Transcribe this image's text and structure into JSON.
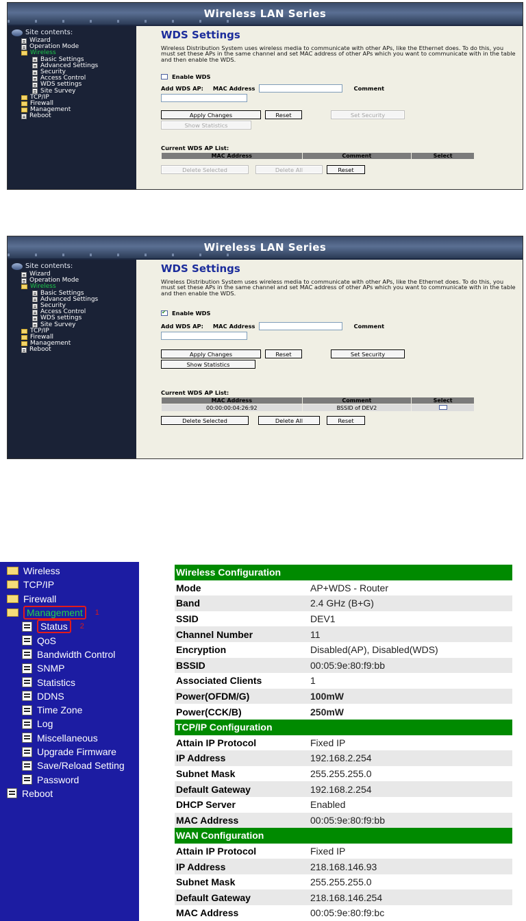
{
  "shot1": {
    "banner": "Wireless LAN Series",
    "site_contents": "Site contents:",
    "nav": [
      {
        "label": "Wizard",
        "icon": "page-icon",
        "level": 1
      },
      {
        "label": "Operation Mode",
        "icon": "page-icon",
        "level": 1
      },
      {
        "label": "Wireless",
        "icon": "folder-open-icon",
        "level": 1,
        "active": true
      },
      {
        "label": "Basic Settings",
        "icon": "page-icon",
        "level": 2
      },
      {
        "label": "Advanced Settings",
        "icon": "page-icon",
        "level": 2
      },
      {
        "label": "Security",
        "icon": "page-icon",
        "level": 2
      },
      {
        "label": "Access Control",
        "icon": "page-icon",
        "level": 2
      },
      {
        "label": "WDS settings",
        "icon": "page-icon",
        "level": 2
      },
      {
        "label": "Site Survey",
        "icon": "page-icon",
        "level": 2
      },
      {
        "label": "TCP/IP",
        "icon": "folder-icon",
        "level": 1
      },
      {
        "label": "Firewall",
        "icon": "folder-icon",
        "level": 1
      },
      {
        "label": "Management",
        "icon": "folder-icon",
        "level": 1
      },
      {
        "label": "Reboot",
        "icon": "page-icon",
        "level": 1
      }
    ],
    "title": "WDS Settings",
    "description": "Wireless Distribution System uses wireless media to communicate with other APs, like the Ethernet does. To do this, you must set these APs in the same channel and set MAC address of other APs which you want to communicate with in the table and then enable the WDS.",
    "enable_wds": "Enable WDS",
    "enable_checked": false,
    "add_wds_ap": "Add WDS AP:",
    "mac_address": "MAC Address",
    "comment": "Comment",
    "apply": "Apply Changes",
    "reset": "Reset",
    "set_security": "Set Security",
    "show_statistics": "Show Statistics",
    "list_title": "Current WDS AP List:",
    "columns": [
      "MAC Address",
      "Comment",
      "Select"
    ],
    "rows": [],
    "delete_selected": "Delete Selected",
    "delete_all": "Delete All",
    "reset2": "Reset"
  },
  "shot2": {
    "banner": "Wireless LAN Series",
    "site_contents": "Site contents:",
    "title": "WDS Settings",
    "description": "Wireless Distribution System uses wireless media to communicate with other APs, like the Ethernet does. To do this, you must set these APs in the same channel and set MAC address of other APs which you want to communicate with in the table and then enable the WDS.",
    "enable_wds": "Enable WDS",
    "enable_checked": true,
    "add_wds_ap": "Add WDS AP:",
    "mac_address": "MAC Address",
    "comment": "Comment",
    "apply": "Apply Changes",
    "reset": "Reset",
    "set_security": "Set Security",
    "show_statistics": "Show Statistics",
    "list_title": "Current WDS AP List:",
    "columns": [
      "MAC Address",
      "Comment",
      "Select"
    ],
    "rows": [
      {
        "mac": "00:00:00:04:26:92",
        "comment": "BSSID of DEV2"
      }
    ],
    "delete_selected": "Delete Selected",
    "delete_all": "Delete All",
    "reset2": "Reset"
  },
  "panel3": {
    "tree": [
      {
        "label": "Wireless",
        "icon": "folder-icon",
        "level": 0
      },
      {
        "label": "TCP/IP",
        "icon": "folder-icon",
        "level": 0
      },
      {
        "label": "Firewall",
        "icon": "folder-icon",
        "level": 0
      },
      {
        "label": "Management",
        "icon": "folder-open-icon",
        "level": 0,
        "green": true,
        "highlight": true,
        "mark": "1"
      },
      {
        "label": "Status",
        "icon": "page-icon",
        "level": 1,
        "highlight": true,
        "mark": "2"
      },
      {
        "label": "QoS",
        "icon": "page-icon",
        "level": 1
      },
      {
        "label": "Bandwidth Control",
        "icon": "page-icon",
        "level": 1
      },
      {
        "label": "SNMP",
        "icon": "page-icon",
        "level": 1
      },
      {
        "label": "Statistics",
        "icon": "page-icon",
        "level": 1
      },
      {
        "label": "DDNS",
        "icon": "page-icon",
        "level": 1
      },
      {
        "label": "Time Zone",
        "icon": "page-icon",
        "level": 1
      },
      {
        "label": "Log",
        "icon": "page-icon",
        "level": 1
      },
      {
        "label": "Miscellaneous",
        "icon": "page-icon",
        "level": 1
      },
      {
        "label": "Upgrade Firmware",
        "icon": "page-icon",
        "level": 1
      },
      {
        "label": "Save/Reload Setting",
        "icon": "page-icon",
        "level": 1
      },
      {
        "label": "Password",
        "icon": "page-icon",
        "level": 1
      },
      {
        "label": "Reboot",
        "icon": "page-icon",
        "level": 0
      }
    ],
    "sections": [
      {
        "title": "Wireless Configuration",
        "rows": [
          [
            "Mode",
            "AP+WDS - Router"
          ],
          [
            "Band",
            "2.4 GHz (B+G)"
          ],
          [
            "SSID",
            "DEV1"
          ],
          [
            "Channel Number",
            "11"
          ],
          [
            "Encryption",
            "Disabled(AP), Disabled(WDS)"
          ],
          [
            "BSSID",
            "00:05:9e:80:f9:bb"
          ],
          [
            "Associated Clients",
            "1"
          ],
          [
            "Power(OFDM/G)",
            "100mW"
          ],
          [
            "Power(CCK/B)",
            "250mW"
          ]
        ]
      },
      {
        "title": "TCP/IP Configuration",
        "rows": [
          [
            "Attain IP Protocol",
            "Fixed IP"
          ],
          [
            "IP Address",
            "192.168.2.254"
          ],
          [
            "Subnet Mask",
            "255.255.255.0"
          ],
          [
            "Default Gateway",
            "192.168.2.254"
          ],
          [
            "DHCP Server",
            "Enabled"
          ],
          [
            "MAC Address",
            "00:05:9e:80:f9:bb"
          ]
        ]
      },
      {
        "title": "WAN Configuration",
        "rows": [
          [
            "Attain IP Protocol",
            "Fixed IP"
          ],
          [
            "IP Address",
            "218.168.146.93"
          ],
          [
            "Subnet Mask",
            "255.255.255.0"
          ],
          [
            "Default Gateway",
            "218.168.146.254"
          ],
          [
            "MAC Address",
            "00:05:9e:80:f9:bc"
          ]
        ]
      }
    ]
  }
}
